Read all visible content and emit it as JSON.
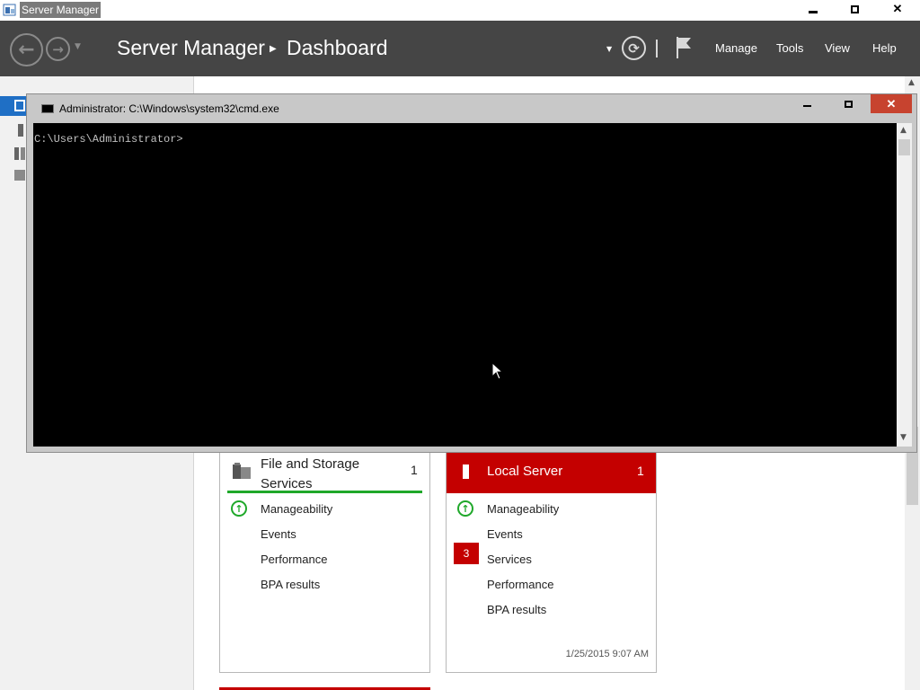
{
  "window": {
    "title": "Server Manager"
  },
  "header": {
    "crumb_app": "Server Manager",
    "crumb_page": "Dashboard",
    "menu": [
      "Manage",
      "Tools",
      "View",
      "Help"
    ]
  },
  "tiles": {
    "file_storage": {
      "title": "File and Storage Services",
      "count": "1",
      "rows": [
        "Manageability",
        "Events",
        "Performance",
        "BPA results"
      ]
    },
    "local_server": {
      "title": "Local Server",
      "count": "1",
      "rows": [
        "Manageability",
        "Events",
        "Services",
        "Performance",
        "BPA results"
      ],
      "services_badge": "3",
      "timestamp": "1/25/2015 9:07 AM"
    }
  },
  "cmd": {
    "title": "Administrator: C:\\Windows\\system32\\cmd.exe",
    "prompt": "C:\\Users\\Administrator>"
  },
  "colors": {
    "header_bg": "#454545",
    "accent_red": "#c40000",
    "ok_green": "#1fa82a",
    "cmd_bg": "#000000"
  }
}
